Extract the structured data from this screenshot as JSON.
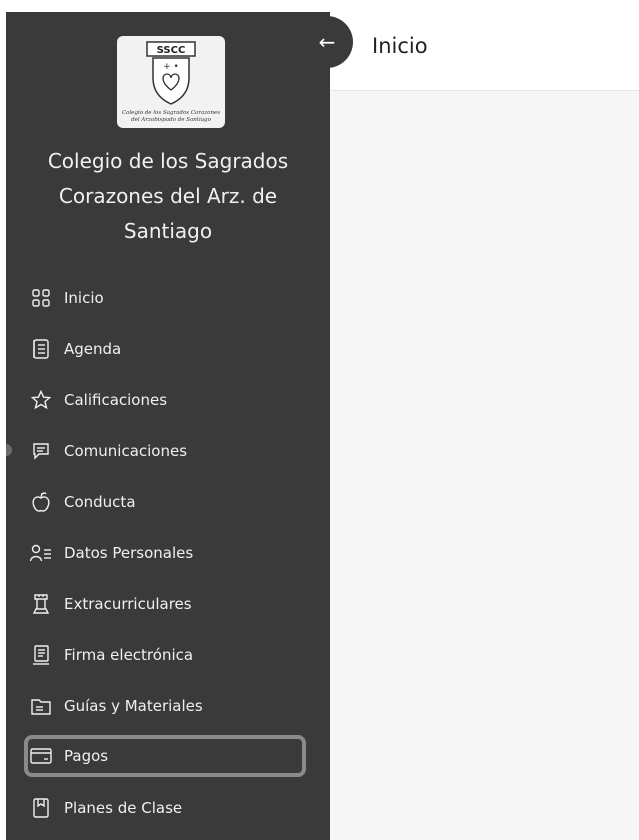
{
  "sidebar": {
    "logo": {
      "abbr": "SSCC",
      "caption_line1": "Colegio de los Sagrados Corazones",
      "caption_line2": "del Arzobispado de Santiago"
    },
    "school_name": "Colegio de los Sagrados Corazones del Arz. de Santiago",
    "items": [
      {
        "label": "Inicio",
        "icon": "grid-icon"
      },
      {
        "label": "Agenda",
        "icon": "agenda-icon"
      },
      {
        "label": "Calificaciones",
        "icon": "star-icon"
      },
      {
        "label": "Comunicaciones",
        "icon": "message-icon"
      },
      {
        "label": "Conducta",
        "icon": "apple-icon"
      },
      {
        "label": "Datos Personales",
        "icon": "person-list-icon"
      },
      {
        "label": "Extracurriculares",
        "icon": "chess-rook-icon"
      },
      {
        "label": "Firma electrónica",
        "icon": "document-sign-icon"
      },
      {
        "label": "Guías y Materiales",
        "icon": "folder-icon"
      },
      {
        "label": "Pagos",
        "icon": "credit-card-icon",
        "selected": true
      },
      {
        "label": "Planes de Clase",
        "icon": "book-icon"
      }
    ]
  },
  "header": {
    "collapse_icon": "arrow-left-icon",
    "collapse_glyph": "←",
    "title": "Inicio"
  },
  "colors": {
    "sidebar_bg": "#3a3a3a",
    "selected_border": "#8a8a8a",
    "text_light": "#f0f0f0"
  }
}
